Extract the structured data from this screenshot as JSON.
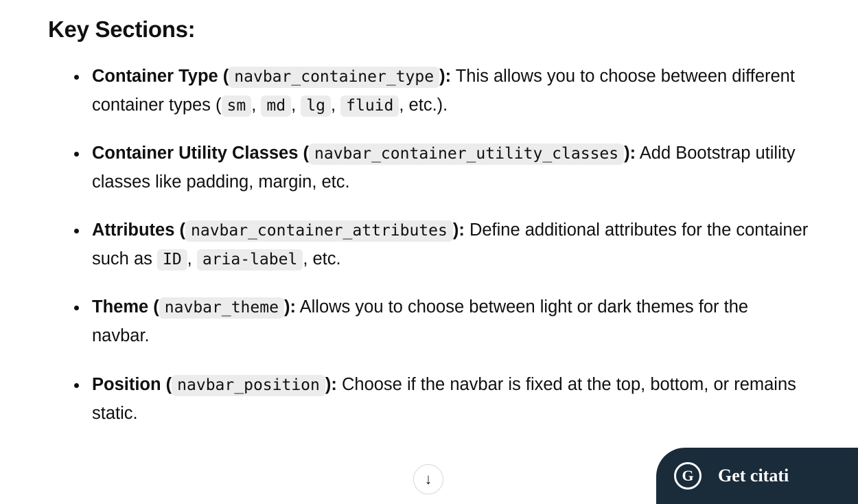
{
  "heading": "Key Sections:",
  "items": [
    {
      "title": "Container Type",
      "param": "navbar_container_type",
      "desc_before": "This allows you to choose between different container types (",
      "codes": [
        "sm",
        "md",
        "lg",
        "fluid"
      ],
      "desc_after": ", etc.)."
    },
    {
      "title": "Container Utility Classes",
      "param": "navbar_container_utility_classes",
      "desc": "Add Bootstrap utility classes like padding, margin, etc."
    },
    {
      "title": "Attributes",
      "param": "navbar_container_attributes",
      "desc_before": "Define additional attributes for the container such as ",
      "codes": [
        "ID",
        "aria-label"
      ],
      "desc_after": ", etc."
    },
    {
      "title": "Theme",
      "param": "navbar_theme",
      "desc": "Allows you to choose between light or dark themes for the navbar."
    },
    {
      "title": "Position",
      "param": "navbar_position",
      "desc": "Choose if the navbar is fixed at the top, bottom, or remains static."
    }
  ],
  "scroll_icon": "↓",
  "citation": {
    "logo_letter": "G",
    "label": "Get citati"
  }
}
